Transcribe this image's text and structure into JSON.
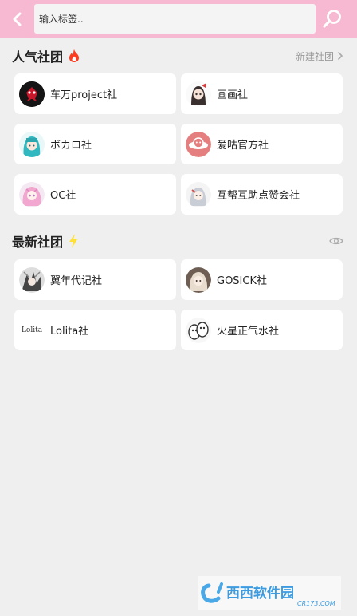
{
  "header": {
    "search_placeholder": "输入标签.."
  },
  "popular": {
    "title": "人气社团",
    "new_club_label": "新建社团",
    "clubs": [
      {
        "label": "车万project社"
      },
      {
        "label": "画画社"
      },
      {
        "label": "ボカロ社"
      },
      {
        "label": "爱咕官方社"
      },
      {
        "label": "OC社"
      },
      {
        "label": "互帮互助点赞会社"
      }
    ]
  },
  "latest": {
    "title": "最新社团",
    "clubs": [
      {
        "label": "翼年代记社"
      },
      {
        "label": "GOSICK社"
      },
      {
        "label": "Lolita社",
        "logo_text": "Lolita"
      },
      {
        "label": "火星正气水社"
      }
    ]
  },
  "watermark": {
    "brand": "西西软件园",
    "domain": "CR173.COM"
  },
  "colors": {
    "header_bg": "#f7b8d2",
    "page_bg": "#efefef",
    "fire": "#ff3b1f",
    "bolt": "#ffe033"
  }
}
